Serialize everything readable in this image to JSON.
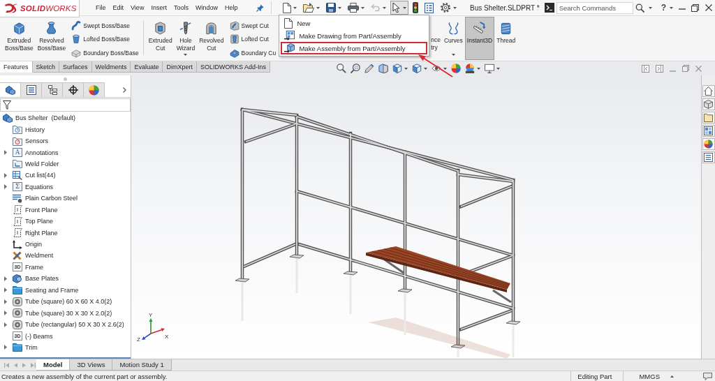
{
  "logo": {
    "text": "**SOLID**WORKS"
  },
  "menu_bar": [
    "File",
    "Edit",
    "View",
    "Insert",
    "Tools",
    "Window",
    "Help"
  ],
  "quick_access": [
    {
      "kind": "new",
      "has_menu": true,
      "pressed": false,
      "disabled": false
    },
    {
      "kind": "open",
      "has_menu": true,
      "pressed": false,
      "disabled": false
    },
    {
      "kind": "save",
      "has_menu": true,
      "pressed": false,
      "disabled": false
    },
    {
      "kind": "print",
      "has_menu": true,
      "pressed": false,
      "disabled": false
    },
    {
      "kind": "undo",
      "has_menu": true,
      "pressed": false,
      "disabled": true
    },
    {
      "kind": "select",
      "has_menu": true,
      "pressed": true,
      "disabled": false
    },
    {
      "kind": "rebuild",
      "has_menu": false,
      "pressed": false,
      "disabled": false
    },
    {
      "kind": "file_properties",
      "has_menu": false,
      "pressed": false,
      "disabled": false
    },
    {
      "kind": "options",
      "has_menu": true,
      "pressed": false,
      "disabled": false
    }
  ],
  "new_menu": {
    "items": [
      {
        "kind": "new",
        "label": "New",
        "highlighted": false
      },
      {
        "kind": "drawing",
        "label": "Make Drawing from Part/Assembly",
        "highlighted": false
      },
      {
        "kind": "assembly",
        "label": "Make Assembly from Part/Assembly",
        "highlighted": true
      }
    ]
  },
  "document_title": "Bus Shelter.SLDPRT *",
  "search": {
    "placeholder": "Search Commands"
  },
  "help": {
    "label": "?"
  },
  "ribbon": {
    "groups": [
      {
        "items": [
          {
            "kind": "extruded_boss",
            "label": "Extruded Boss/Base",
            "selected": false,
            "has_menu": false
          },
          {
            "kind": "revolved_boss",
            "label": "Revolved Boss/Base",
            "selected": false,
            "has_menu": false
          },
          {
            "kind": "stack",
            "items": [
              {
                "kind": "swept_boss",
                "label": "Swept Boss/Base"
              },
              {
                "kind": "lofted_boss",
                "label": "Lofted Boss/Base"
              },
              {
                "kind": "boundary_boss",
                "label": "Boundary Boss/Base"
              }
            ]
          }
        ]
      },
      {
        "items": [
          {
            "kind": "extruded_cut",
            "label": "Extruded Cut",
            "selected": false,
            "has_menu": false
          },
          {
            "kind": "hole_wizard",
            "label": "Hole Wizard",
            "selected": false,
            "has_menu": true
          },
          {
            "kind": "revolved_cut",
            "label": "Revolved Cut",
            "selected": false,
            "has_menu": false
          },
          {
            "kind": "stack",
            "items": [
              {
                "kind": "swept_cut",
                "label": "Swept Cut"
              },
              {
                "kind": "lofted_cut",
                "label": "Lofted Cut"
              },
              {
                "kind": "boundary_cut",
                "label": "Boundary Cu"
              }
            ]
          }
        ]
      },
      {
        "items": [
          {
            "kind": "clipped",
            "label": "nce try"
          },
          {
            "kind": "curves",
            "label": "Curves",
            "selected": false,
            "has_menu": true
          },
          {
            "kind": "instant3d",
            "label": "Instant3D",
            "selected": true,
            "has_menu": false
          },
          {
            "kind": "thread",
            "label": "Thread",
            "selected": false,
            "has_menu": false
          }
        ]
      }
    ]
  },
  "feature_tabs": [
    {
      "label": "Features",
      "selected": true
    },
    {
      "label": "Sketch",
      "selected": false
    },
    {
      "label": "Surfaces",
      "selected": false
    },
    {
      "label": "Weldments",
      "selected": false
    },
    {
      "label": "Evaluate",
      "selected": false
    },
    {
      "label": "DimXpert",
      "selected": false
    },
    {
      "label": "SOLIDWORKS Add-Ins",
      "selected": false
    }
  ],
  "panel_tabs": [
    {
      "kind": "feature_tree",
      "selected": true
    },
    {
      "kind": "properties",
      "selected": false
    },
    {
      "kind": "configurations",
      "selected": false
    },
    {
      "kind": "dimxpert",
      "selected": false
    },
    {
      "kind": "display",
      "selected": false
    }
  ],
  "feature_tree": {
    "root": {
      "kind": "part",
      "label": "Bus Shelter  (Default)",
      "children": [
        {
          "kind": "history",
          "label": "History",
          "expandable": false
        },
        {
          "kind": "sensors",
          "label": "Sensors",
          "expandable": false
        },
        {
          "kind": "annotations",
          "label": "Annotations",
          "expandable": true,
          "icon_text": "A"
        },
        {
          "kind": "weld_folder",
          "label": "Weld Folder",
          "expandable": false
        },
        {
          "kind": "cut_list",
          "label": "Cut list(44)",
          "expandable": true
        },
        {
          "kind": "equations",
          "label": "Equations",
          "expandable": true,
          "icon_text": "Σ"
        },
        {
          "kind": "material",
          "label": "Plain Carbon Steel",
          "expandable": false
        },
        {
          "kind": "plane",
          "label": "Front Plane",
          "expandable": false
        },
        {
          "kind": "plane",
          "label": "Top Plane",
          "expandable": false
        },
        {
          "kind": "plane",
          "label": "Right Plane",
          "expandable": false
        },
        {
          "kind": "origin",
          "label": "Origin",
          "expandable": false
        },
        {
          "kind": "weldment",
          "label": "Weldment",
          "expandable": false
        },
        {
          "kind": "sketch3d",
          "label": "Frame",
          "expandable": false,
          "icon_text": "3D"
        },
        {
          "kind": "body",
          "label": "Base Plates",
          "expandable": true
        },
        {
          "kind": "folder",
          "label": "Seating and Frame",
          "expandable": true
        },
        {
          "kind": "profile",
          "label": "Tube (square) 60 X 60 X 4.0(2)",
          "expandable": true
        },
        {
          "kind": "profile",
          "label": "Tube (square) 30 X 30 X 2.0(2)",
          "expandable": true
        },
        {
          "kind": "profile",
          "label": "Tube (rectangular) 50 X 30 X 2.6(2)",
          "expandable": true
        },
        {
          "kind": "sketch3d",
          "label": "(-) Beams",
          "expandable": false,
          "icon_text": "3D"
        },
        {
          "kind": "folder",
          "label": "Trim",
          "expandable": true
        }
      ]
    }
  },
  "triad": {
    "axes": [
      {
        "kind": "y",
        "label": "Y"
      },
      {
        "kind": "z",
        "label": "Z"
      },
      {
        "kind": "x",
        "label": "X"
      }
    ]
  },
  "bottom_tabs": [
    {
      "label": "Model",
      "selected": true
    },
    {
      "label": "3D Views",
      "selected": false
    },
    {
      "label": "Motion Study 1",
      "selected": false
    }
  ],
  "status_bar": {
    "message": "Creates a new assembly of the current part or assembly.",
    "mode": "Editing Part",
    "units": "MMGS"
  }
}
